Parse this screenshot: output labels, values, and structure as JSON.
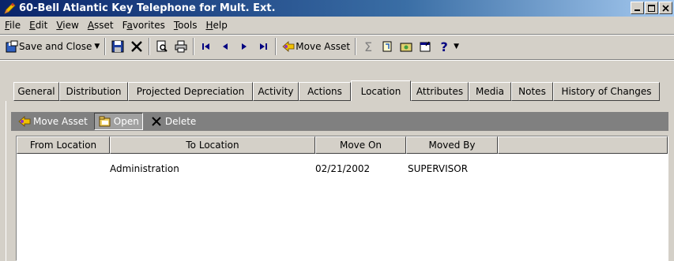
{
  "window": {
    "title": "60-Bell Atlantic Key Telephone for Mult. Ext.",
    "icon": "pencil-icon",
    "controls": [
      "minimize-icon",
      "maximize-icon",
      "close-icon"
    ]
  },
  "menu": {
    "items": [
      {
        "label": "File",
        "accel": "F"
      },
      {
        "label": "Edit",
        "accel": "E"
      },
      {
        "label": "View",
        "accel": "V"
      },
      {
        "label": "Asset",
        "accel": "A"
      },
      {
        "label": "Favorites",
        "accel": "a"
      },
      {
        "label": "Tools",
        "accel": "T"
      },
      {
        "label": "Help",
        "accel": "H"
      }
    ]
  },
  "toolbar": {
    "save_close_label": "Save and Close",
    "move_asset_label": "Move Asset",
    "help_icon_label": "?"
  },
  "tabs": {
    "items": [
      {
        "label": "General"
      },
      {
        "label": "Distribution"
      },
      {
        "label": "Projected Depreciation"
      },
      {
        "label": "Activity"
      },
      {
        "label": "Actions"
      },
      {
        "label": "Location",
        "active": true
      },
      {
        "label": "Attributes"
      },
      {
        "label": "Media"
      },
      {
        "label": "Notes"
      },
      {
        "label": "History of Changes"
      }
    ]
  },
  "location_toolbar": {
    "move_asset_label": "Move Asset",
    "open_label": "Open",
    "delete_label": "Delete"
  },
  "grid": {
    "columns": [
      "From Location",
      "To Location",
      "Move On",
      "Moved By",
      ""
    ],
    "rows": [
      {
        "from": "",
        "to": "Administration",
        "moved_on": "02/21/2002",
        "moved_by": "SUPERVISOR"
      }
    ]
  },
  "colors": {
    "title_gradient_start": "#0a246a",
    "title_gradient_end": "#a6caf0",
    "face": "#d4d0c8",
    "subbar": "#808080"
  }
}
